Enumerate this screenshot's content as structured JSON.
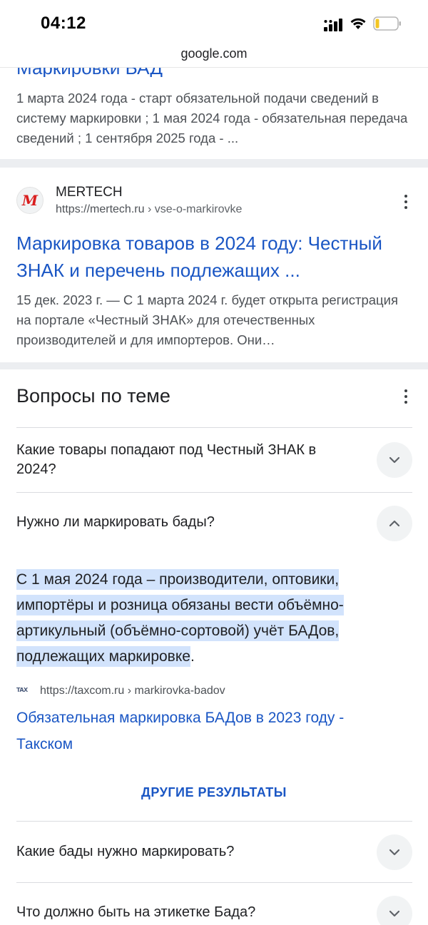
{
  "status_bar": {
    "time": "04:12"
  },
  "browser": {
    "url": "google.com"
  },
  "result_partial": {
    "title_fragment": "Маркировки БАД",
    "snippet": "1 марта 2024 года - старт обязательной подачи сведений в систему маркировки ; 1 мая 2024 года - обязательная передача сведений ; 1 сентября 2025 года - ..."
  },
  "result_mertech": {
    "site_name": "MERTECH",
    "url_domain": "https://mertech.ru",
    "url_path": " › vse-o-markirovke",
    "favicon_letter": "M",
    "title": "Маркировка товаров в 2024 году: Честный ЗНАК и перечень подлежащих ...",
    "snippet": "15 дек. 2023 г. — С 1 марта 2024 г. будет открыта регистрация на портале «Честный ЗНАК» для отечественных производителей и для импортеров. Они…"
  },
  "paa": {
    "heading": "Вопросы по теме",
    "questions": [
      {
        "text": "Какие товары попадают под Честный ЗНАК в 2024?",
        "expanded": false
      },
      {
        "text": "Нужно ли маркировать бады?",
        "expanded": true
      },
      {
        "text": "Какие бады нужно маркировать?",
        "expanded": false
      },
      {
        "text": "Что должно быть на этикетке Бада?",
        "expanded": false
      }
    ],
    "answer": {
      "text_highlighted": "С 1 мая 2024 года – производители, оптовики, импортёры и розница обязаны вести объёмно-артикульный (объёмно-сортовой) учёт БАДов, подлежащих маркировке",
      "text_tail": ".",
      "source_icon": "TAX",
      "source_domain": "https://taxcom.ru",
      "source_path": " › markirovka-badov",
      "source_title": "Обязательная маркировка БАДов в 2023 году - Такском"
    },
    "more_results": "ДРУГИЕ РЕЗУЛЬТАТЫ"
  },
  "colors": {
    "link": "#1a56c4",
    "highlight": "#d2e3fc",
    "band": "#eceef1"
  }
}
